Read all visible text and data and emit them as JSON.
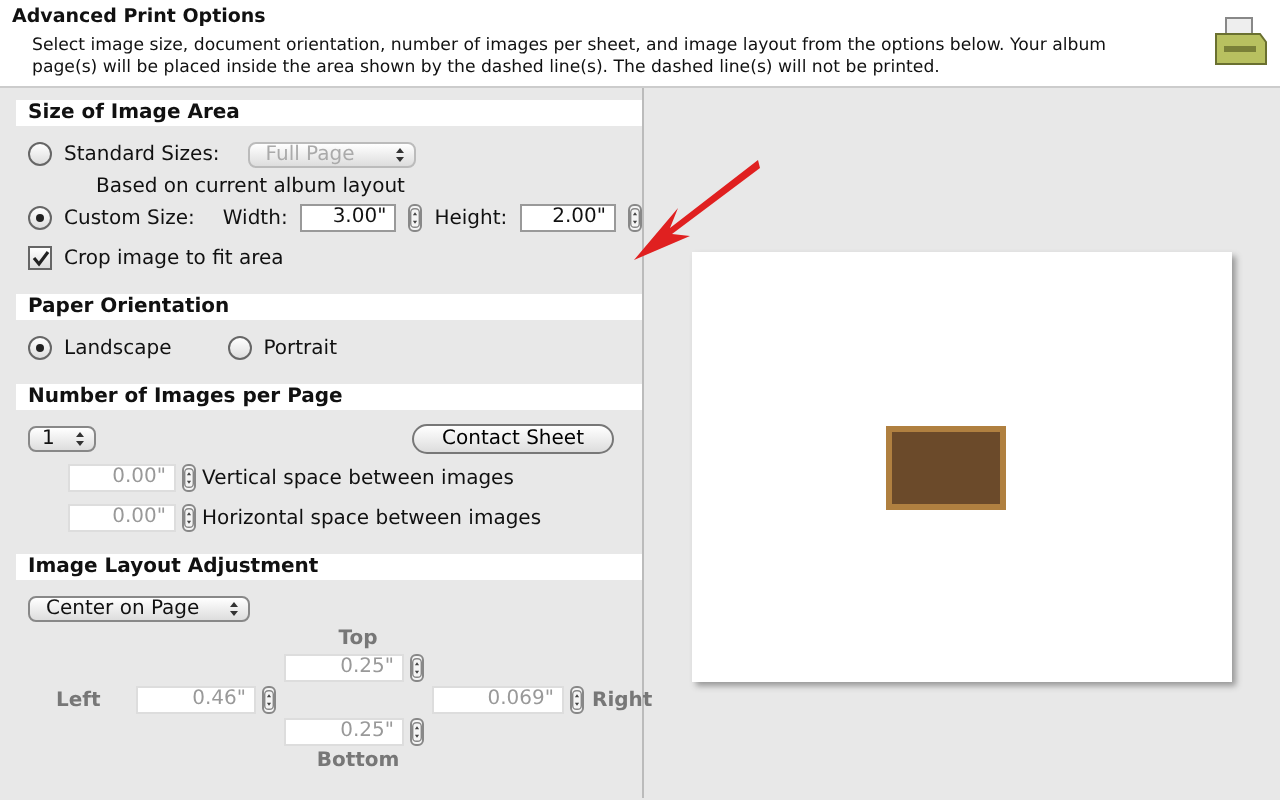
{
  "header": {
    "title": "Advanced Print Options",
    "description": "Select image size, document orientation, number of images per sheet, and image layout from the options below. Your album page(s) will be placed inside the area shown by the dashed line(s). The dashed line(s) will not be printed."
  },
  "size_section": {
    "title": "Size of Image Area",
    "standard": {
      "label": "Standard Sizes:",
      "selected": false,
      "popup": "Full Page",
      "popup_disabled": true,
      "note": "Based on current album layout"
    },
    "custom": {
      "label": "Custom Size:",
      "selected": true,
      "width_label": "Width:",
      "width": "3.00\"",
      "height_label": "Height:",
      "height": "2.00\""
    },
    "crop": {
      "label": "Crop image to fit area",
      "checked": true
    }
  },
  "orientation_section": {
    "title": "Paper Orientation",
    "options": [
      {
        "label": "Landscape",
        "selected": true
      },
      {
        "label": "Portrait",
        "selected": false
      }
    ]
  },
  "images_section": {
    "title": "Number of Images per Page",
    "count": "1",
    "button": "Contact Sheet",
    "spacing": [
      {
        "value": "0.00\"",
        "label": "Vertical space between images",
        "disabled": true
      },
      {
        "value": "0.00\"",
        "label": "Horizontal space between images",
        "disabled": true
      }
    ]
  },
  "layout_section": {
    "title": "Image Layout Adjustment",
    "popup": "Center on Page",
    "margins_disabled": true,
    "top_label": "Top",
    "top": "0.25\"",
    "left_label": "Left",
    "left": "0.46\"",
    "bottom": "0.25\"",
    "right": "0.069\"",
    "right_label": "Right",
    "bottom_label": "Bottom"
  }
}
